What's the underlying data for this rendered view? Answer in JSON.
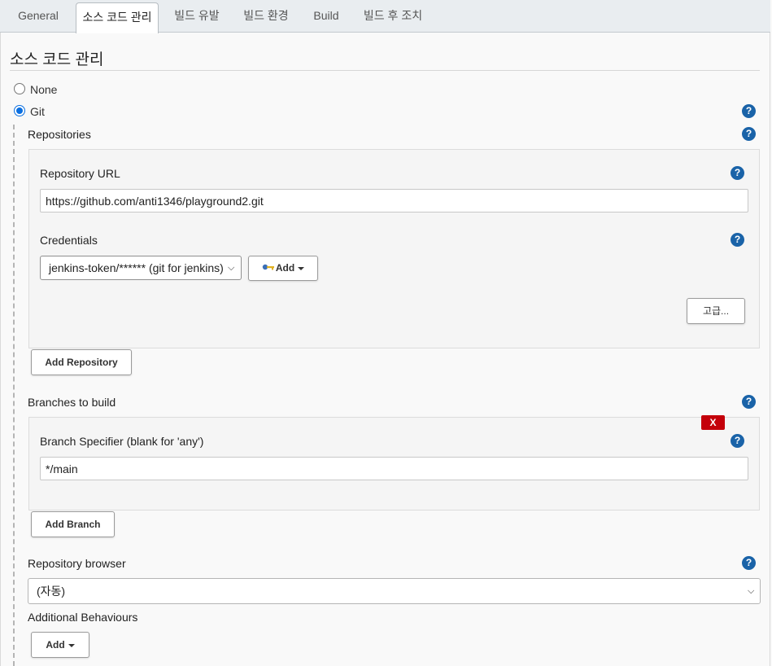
{
  "tabs": [
    {
      "label": "General"
    },
    {
      "label": "소스 코드 관리"
    },
    {
      "label": "빌드 유발"
    },
    {
      "label": "빌드 환경"
    },
    {
      "label": "Build"
    },
    {
      "label": "빌드 후 조치"
    }
  ],
  "active_tab": "소스 코드 관리",
  "section": {
    "title": "소스 코드 관리"
  },
  "scm": {
    "none_label": "None",
    "git_label": "Git",
    "selected": "Git"
  },
  "help": {
    "glyph": "?"
  },
  "repositories": {
    "label": "Repositories",
    "url_label": "Repository URL",
    "url_value": "https://github.com/anti1346/playground2.git",
    "credentials_label": "Credentials",
    "credentials_value": "jenkins-token/****** (git for jenkins)",
    "add_label": "Add",
    "advanced_label": "고급...",
    "add_repository_label": "Add Repository"
  },
  "branches": {
    "label": "Branches to build",
    "delete_label": "X",
    "specifier_label": "Branch Specifier (blank for 'any')",
    "specifier_value": "*/main",
    "add_branch_label": "Add Branch"
  },
  "repository_browser": {
    "label": "Repository browser",
    "value": "(자동)"
  },
  "additional_behaviours": {
    "label": "Additional Behaviours",
    "add_label": "Add"
  },
  "colors": {
    "help_icon": "#1a63a8",
    "delete_button": "#c4000a",
    "radio_checked": "#0b6fe0"
  }
}
